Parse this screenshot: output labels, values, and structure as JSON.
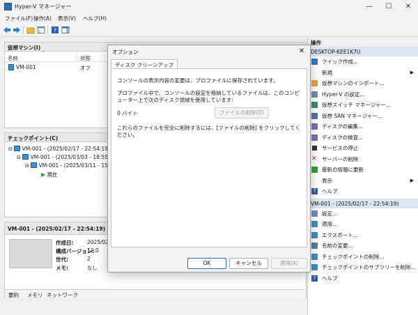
{
  "window": {
    "title": "Hyper-V マネージャー"
  },
  "menu": {
    "items": [
      "ファイル(F)",
      "操作(A)",
      "表示(V)",
      "ヘルプ(H)"
    ]
  },
  "vm_pane": {
    "header": "仮想マシン(I)",
    "col_name": "名前",
    "col_state": "状態",
    "rows": [
      {
        "name": "VM-001",
        "state": "オフ"
      }
    ]
  },
  "checkpoint_pane": {
    "header": "チェックポイント(C)",
    "items": [
      "VM-001 - (2025/02/17 - 22:54:19)",
      "VM-001 - (2025/03/03 - 18:55:5",
      "VM-001 - (2025/03/11 - 15",
      "現在"
    ]
  },
  "details_pane": {
    "header": "VM-001 - (2025/02/17 - 22:54:19)",
    "fields": [
      {
        "label": "作成日:",
        "value": "2025/02/"
      },
      {
        "label": "構成バージョン:",
        "value": "12.0"
      },
      {
        "label": "世代:",
        "value": "2"
      },
      {
        "label": "メモ:",
        "value": "なし"
      }
    ],
    "tabs": [
      "要約",
      "メモリ",
      "ネットワーク"
    ]
  },
  "actions_pane": {
    "title": "操作",
    "host_group": "DESKTOP-KEE1K7U",
    "host_items": [
      {
        "label": "クイック作成...",
        "icon": "quick-create-icon",
        "submenu": false
      },
      {
        "label": "新規",
        "icon": "",
        "submenu": true
      },
      {
        "label": "仮想マシンのインポート...",
        "icon": "import-icon",
        "submenu": false
      },
      {
        "label": "Hyper-V の設定...",
        "icon": "settings-icon",
        "submenu": false
      },
      {
        "label": "仮想スイッチ マネージャー...",
        "icon": "switch-icon",
        "submenu": false
      },
      {
        "label": "仮想 SAN マネージャー...",
        "icon": "san-icon",
        "submenu": false
      },
      {
        "label": "ディスクの編集...",
        "icon": "disk-edit-icon",
        "submenu": false
      },
      {
        "label": "ディスクの検査...",
        "icon": "disk-inspect-icon",
        "submenu": false
      },
      {
        "label": "サービスの停止",
        "icon": "stop-icon",
        "submenu": false
      },
      {
        "label": "サーバーの削除",
        "icon": "remove-icon",
        "submenu": false
      },
      {
        "label": "最新の情報に更新",
        "icon": "refresh-icon",
        "submenu": false
      },
      {
        "label": "表示",
        "icon": "",
        "submenu": true
      },
      {
        "label": "ヘルプ",
        "icon": "help-icon",
        "submenu": false
      }
    ],
    "checkpoint_group": "VM-001 - (2025/02/17 - 22:54:19)",
    "checkpoint_items": [
      {
        "label": "設定...",
        "icon": "settings-icon"
      },
      {
        "label": "適用...",
        "icon": "apply-icon"
      },
      {
        "label": "エクスポート...",
        "icon": "export-icon"
      },
      {
        "label": "名前の変更...",
        "icon": "rename-icon"
      },
      {
        "label": "チェックポイントの削除...",
        "icon": "delete-checkpoint-icon"
      },
      {
        "label": "チェックポイントのサブツリーを削除...",
        "icon": "delete-subtree-icon"
      },
      {
        "label": "ヘルプ",
        "icon": "help-icon"
      }
    ]
  },
  "dialog": {
    "title": "オプション",
    "tab": "ディスク クリーンアップ",
    "text1": "コンソールの表示内容の変更は、プロファイルに保存されています。",
    "text2": "プロファイル中で、コンソールの設定を格納しているファイルは、このコンピューター上で次のディスク領域を使用しています:",
    "size": "0 バイト",
    "delete_files_label": "ファイルの削除(D)",
    "text3": "これらのファイルを完全に削除するには、[ファイルの削除] をクリックしてください。",
    "ok": "OK",
    "cancel": "キャンセル",
    "apply": "適用(A)"
  }
}
